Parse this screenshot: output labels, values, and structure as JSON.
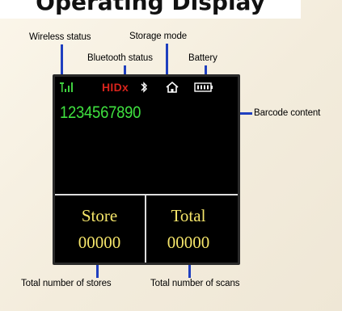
{
  "title": "Operating Display",
  "annotations": {
    "wireless": "Wireless status",
    "storage": "Storage mode",
    "bluetooth": "Bluetooth status",
    "battery": "Battery",
    "barcode": "Barcode content",
    "stores": "Total number of stores",
    "scans": "Total number of scans"
  },
  "screen": {
    "mode": "HIDx",
    "barcode": "1234567890",
    "store_label": "Store",
    "store_value": "00000",
    "total_label": "Total",
    "total_value": "00000"
  },
  "colors": {
    "signal": "#3fcf3f",
    "hid": "#d8241c",
    "barcode": "#3fe03f",
    "counter_text": "#f5e56a",
    "callout_line": "#1f3fbf"
  },
  "icons": [
    "signal-icon",
    "bluetooth-icon",
    "home-icon",
    "battery-icon"
  ]
}
